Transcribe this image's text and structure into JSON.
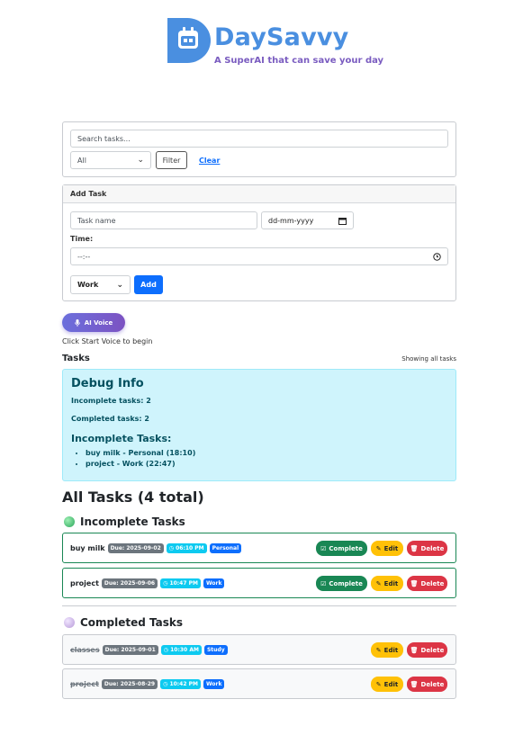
{
  "brand": {
    "name": "DaySavvy",
    "tagline": "A SuperAI that can save your day"
  },
  "filter": {
    "search_placeholder": "Search tasks...",
    "status_selected": "All",
    "filter_label": "Filter",
    "clear_label": "Clear"
  },
  "add_task": {
    "header": "Add Task",
    "name_placeholder": "Task name",
    "date_placeholder": "dd-mm-yyyy",
    "time_label": "Time:",
    "time_placeholder": "--:--",
    "category_selected": "Work",
    "add_label": "Add"
  },
  "voice": {
    "button_label": "AI Voice",
    "hint": "Click Start Voice to begin"
  },
  "tasks_header": {
    "title": "Tasks",
    "showing": "Showing all tasks"
  },
  "debug": {
    "title": "Debug Info",
    "incomplete_count": "Incomplete tasks: 2",
    "completed_count": "Completed tasks: 2",
    "list_title": "Incomplete Tasks:",
    "items": [
      "buy milk - Personal (18:10)",
      "project - Work (22:47)"
    ]
  },
  "all_title": "All Tasks (4 total)",
  "incomplete_title": "Incomplete Tasks",
  "completed_title": "Completed Tasks",
  "incomplete_tasks": [
    {
      "name": "buy milk",
      "due": "Due: 2025-09-02",
      "time": "06:10 PM",
      "category": "Personal"
    },
    {
      "name": "project",
      "due": "Due: 2025-09-06",
      "time": "10:47 PM",
      "category": "Work"
    }
  ],
  "completed_tasks": [
    {
      "name": "classes",
      "due": "Due: 2025-09-01",
      "time": "10:30 AM",
      "category": "Study"
    },
    {
      "name": "project",
      "due": "Due: 2025-08-29",
      "time": "10:42 PM",
      "category": "Work"
    }
  ],
  "actions": {
    "complete": "Complete",
    "edit": "Edit",
    "delete": "Delete"
  },
  "colors": {
    "brand_blue": "#4a8fe0",
    "tagline_purple": "#7a5cc0",
    "primary": "#0d6efd",
    "success": "#198754",
    "warning": "#ffc107",
    "danger": "#dc3545",
    "info_bg": "#cff4fc"
  },
  "icons": {
    "logo": "calendar-d-logo",
    "voice": "microphone-icon",
    "time": "clock-icon",
    "edit": "pencil-icon",
    "delete": "trash-icon",
    "complete": "checkbox-icon"
  }
}
